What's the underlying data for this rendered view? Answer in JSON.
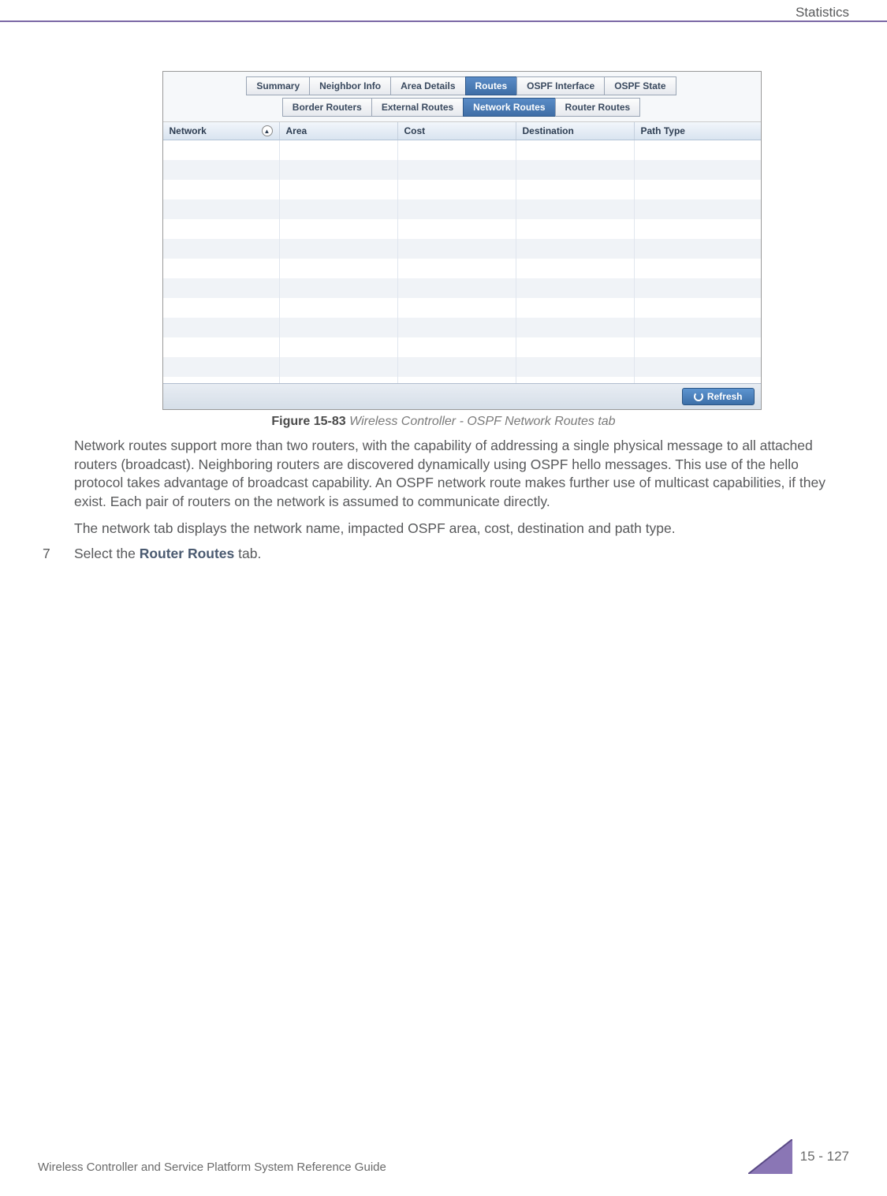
{
  "header": {
    "section": "Statistics"
  },
  "screenshot": {
    "tabs_top": [
      "Summary",
      "Neighbor Info",
      "Area Details",
      "Routes",
      "OSPF Interface",
      "OSPF State"
    ],
    "tabs_top_active_index": 3,
    "tabs_sub": [
      "Border Routers",
      "External Routes",
      "Network Routes",
      "Router Routes"
    ],
    "tabs_sub_active_index": 2,
    "columns": [
      "Network",
      "Area",
      "Cost",
      "Destination",
      "Path Type"
    ],
    "refresh_label": "Refresh"
  },
  "figure": {
    "label": "Figure 15-83",
    "title": "Wireless Controller - OSPF Network Routes tab"
  },
  "paragraphs": {
    "p1": "Network routes support more than two routers, with the capability of addressing a single physical message to all attached routers (broadcast). Neighboring routers are discovered dynamically using OSPF hello messages. This use of the hello protocol takes advantage of broadcast capability. An OSPF network route makes further use of multicast capabilities, if they exist. Each pair of routers on the network is assumed to communicate directly.",
    "p2": "The network tab displays the network name, impacted OSPF area, cost, destination and path type."
  },
  "step": {
    "num": "7",
    "prefix": "Select the ",
    "link": "Router Routes",
    "suffix": " tab."
  },
  "footer": {
    "guide": "Wireless Controller and Service Platform System Reference Guide",
    "page": "15 - 127"
  }
}
